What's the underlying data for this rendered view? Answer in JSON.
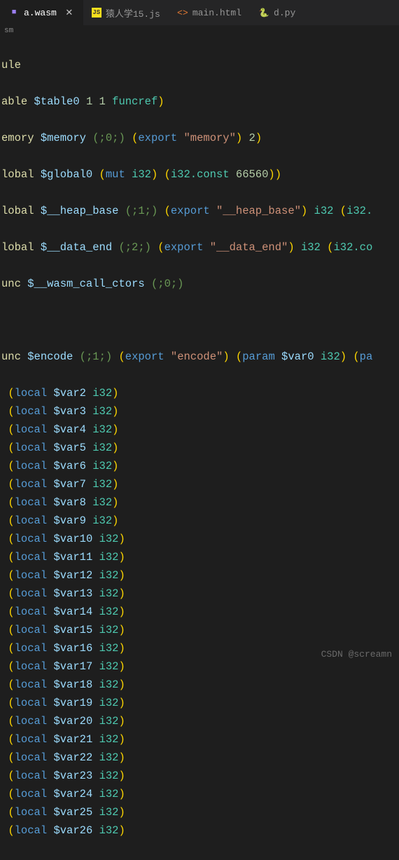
{
  "tabs": [
    {
      "label": "a.wasm",
      "active": true
    },
    {
      "label": "猿人学15.js",
      "active": false
    },
    {
      "label": "main.html",
      "active": false
    },
    {
      "label": "d.py",
      "active": false
    }
  ],
  "breadcrumb": "sm",
  "code": {
    "l1": "ule",
    "l2_a": "able ",
    "l2_b": "$table0 ",
    "l2_c": "1 1 ",
    "l2_d": "funcref",
    "l2_e": ")",
    "l3_a": "emory ",
    "l3_b": "$memory ",
    "l3_c": "(;",
    "l3_d": "0",
    "l3_e": ";) ",
    "l3_f": "(",
    "l3_g": "export ",
    "l3_h": "\"memory\"",
    "l3_i": ") ",
    "l3_j": "2",
    "l3_k": ")",
    "l4_a": "lobal ",
    "l4_b": "$global0 ",
    "l4_c": "(",
    "l4_d": "mut ",
    "l4_e": "i32",
    "l4_f": ") (",
    "l4_g": "i32.const ",
    "l4_h": "66560",
    "l4_i": "))",
    "l5_a": "lobal ",
    "l5_b": "$__heap_base ",
    "l5_c": "(;",
    "l5_d": "1",
    "l5_e": ";) ",
    "l5_f": "(",
    "l5_g": "export ",
    "l5_h": "\"__heap_base\"",
    "l5_i": ") ",
    "l5_j": "i32 ",
    "l5_k": "(",
    "l5_l": "i32.",
    "l6_a": "lobal ",
    "l6_b": "$__data_end ",
    "l6_c": "(;",
    "l6_d": "2",
    "l6_e": ";) ",
    "l6_f": "(",
    "l6_g": "export ",
    "l6_h": "\"__data_end\"",
    "l6_i": ") ",
    "l6_j": "i32 ",
    "l6_k": "(",
    "l6_l": "i32.co",
    "l7_a": "unc ",
    "l7_b": "$__wasm_call_ctors ",
    "l7_c": "(;",
    "l7_d": "0",
    "l7_e": ";)",
    "l8_a": "unc ",
    "l8_b": "$encode ",
    "l8_c": "(;",
    "l8_d": "1",
    "l8_e": ";) ",
    "l8_f": "(",
    "l8_g": "export ",
    "l8_h": "\"encode\"",
    "l8_i": ") (",
    "l8_j": "param ",
    "l8_k": "$var0 ",
    "l8_l": "i32",
    "l8_m": ") (",
    "l8_n": "pa",
    "locals": [
      "$var2",
      "$var3",
      "$var4",
      "$var5",
      "$var6",
      "$var7",
      "$var8",
      "$var9",
      "$var10",
      "$var11",
      "$var12",
      "$var13",
      "$var14",
      "$var15",
      "$var16",
      "$var17",
      "$var18",
      "$var19",
      "$var20",
      "$var21",
      "$var22",
      "$var23",
      "$var24",
      "$var25",
      "$var26"
    ],
    "local_kw": "local ",
    "local_type": "i32",
    "paren_open": "(",
    "paren_close": ")"
  },
  "watermark": "CSDN @screamn"
}
